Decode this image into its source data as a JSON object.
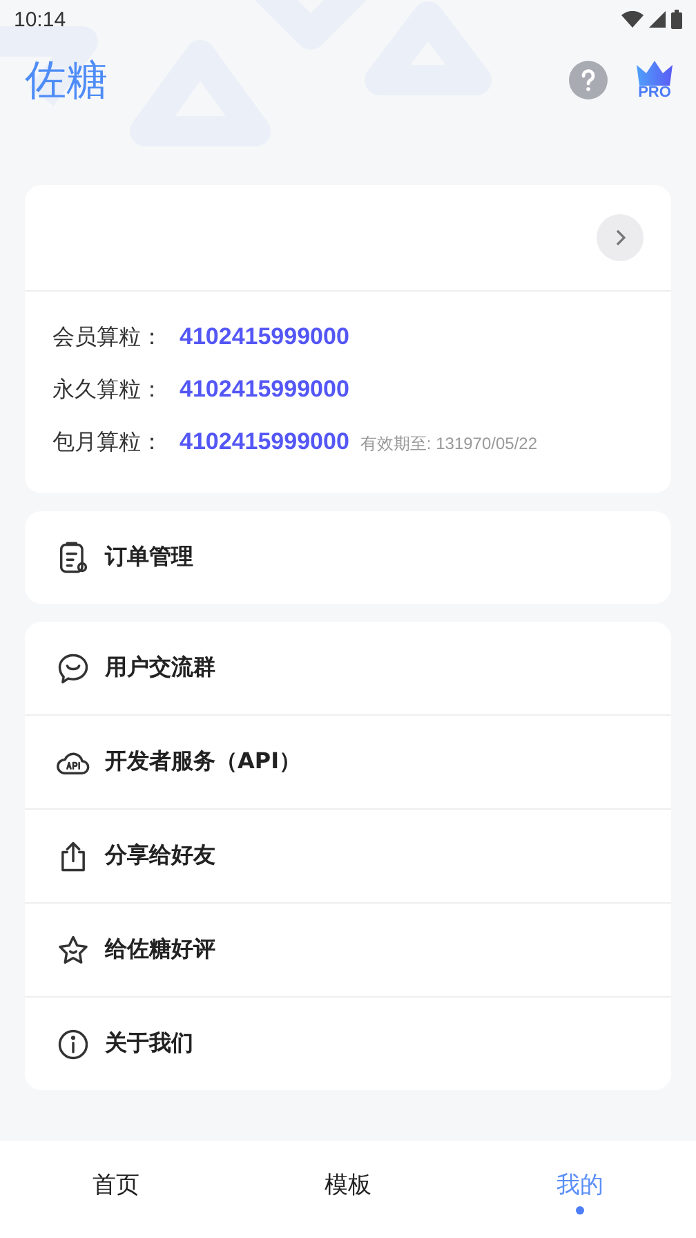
{
  "status_bar": {
    "time": "10:14"
  },
  "header": {
    "title": "佐糖",
    "pro_badge": "PRO"
  },
  "account_card": {
    "credits": [
      {
        "label": "会员算粒：",
        "value": "4102415999000"
      },
      {
        "label": "永久算粒：",
        "value": "4102415999000"
      },
      {
        "label": "包月算粒：",
        "value": "4102415999000",
        "note": "有效期至: 131970/05/22"
      }
    ]
  },
  "order_menu": [
    {
      "kind": "order",
      "label": "订单管理"
    }
  ],
  "menu": [
    {
      "kind": "chat",
      "label": "用户交流群"
    },
    {
      "kind": "api",
      "label": "开发者服务（API）"
    },
    {
      "kind": "share",
      "label": "分享给好友"
    },
    {
      "kind": "star",
      "label": "给佐糖好评"
    },
    {
      "kind": "info",
      "label": "关于我们"
    }
  ],
  "bottom_nav": [
    {
      "label": "首页",
      "selected": false
    },
    {
      "label": "模板",
      "selected": false
    },
    {
      "label": "我的",
      "selected": true
    }
  ]
}
